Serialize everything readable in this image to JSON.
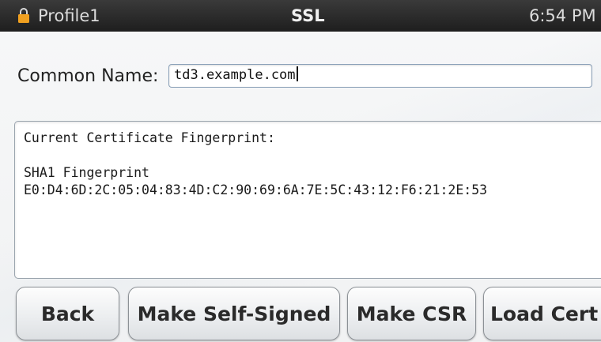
{
  "status_bar": {
    "icon": "lock-icon",
    "profile": "Profile1",
    "title": "SSL",
    "time": "6:54 PM"
  },
  "form": {
    "common_name_label": "Common Name:",
    "common_name_value": "td3.example.com"
  },
  "certificate": {
    "heading": "Current Certificate Fingerprint:",
    "fingerprint_label": "SHA1 Fingerprint",
    "fingerprint_value": "E0:D4:6D:2C:05:04:83:4D:C2:90:69:6A:7E:5C:43:12:F6:21:2E:53"
  },
  "buttons": {
    "back": "Back",
    "make_self_signed": "Make Self-Signed",
    "make_csr": "Make CSR",
    "load_cert": "Load Cert"
  },
  "colors": {
    "status_bar_bg": "#1e1e1e",
    "lock_icon": "#f0a020",
    "input_border": "#8aa0b8"
  }
}
